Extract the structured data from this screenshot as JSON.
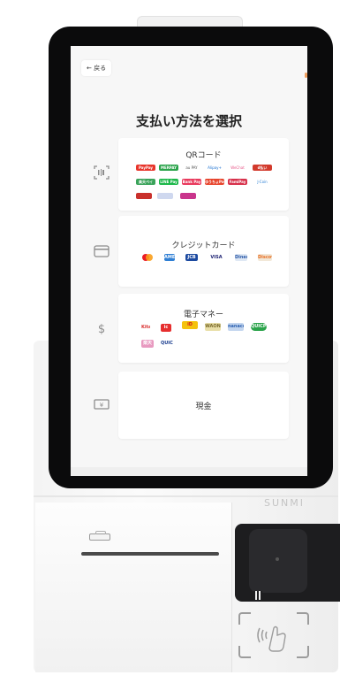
{
  "device": {
    "brand": "SUNMI"
  },
  "screen": {
    "back_label": "← 戻る",
    "title": "支払い方法を選択",
    "options": [
      {
        "label": "QRコード",
        "icon": "qr-scan-icon",
        "logos": [
          "PayPay",
          "MERPAY",
          "au PAY",
          "d払い",
          "楽天ペイ",
          "LINE Pay",
          "Alipay+",
          "WeChat",
          "Bank Pay",
          "ゆうちょPay",
          "FamiPay",
          "J-Coin"
        ]
      },
      {
        "label": "クレジットカード",
        "icon": "credit-card-icon",
        "logos": [
          "Mastercard",
          "AMEX",
          "JCB",
          "VISA",
          "Diners",
          "Discover"
        ]
      },
      {
        "label": "電子マネー",
        "icon": "dollar-icon",
        "logos": [
          "Kitaca",
          "ic",
          "iD",
          "WAON",
          "nanaco",
          "QUICPay",
          "楽天Edy",
          "QUICPay+"
        ]
      },
      {
        "label": "現金",
        "icon": "cash-icon",
        "logos": []
      }
    ]
  },
  "colors": {
    "screen_bg": "#f7f7f7",
    "card_bg": "#ffffff",
    "bezel": "#0b0b0c"
  }
}
